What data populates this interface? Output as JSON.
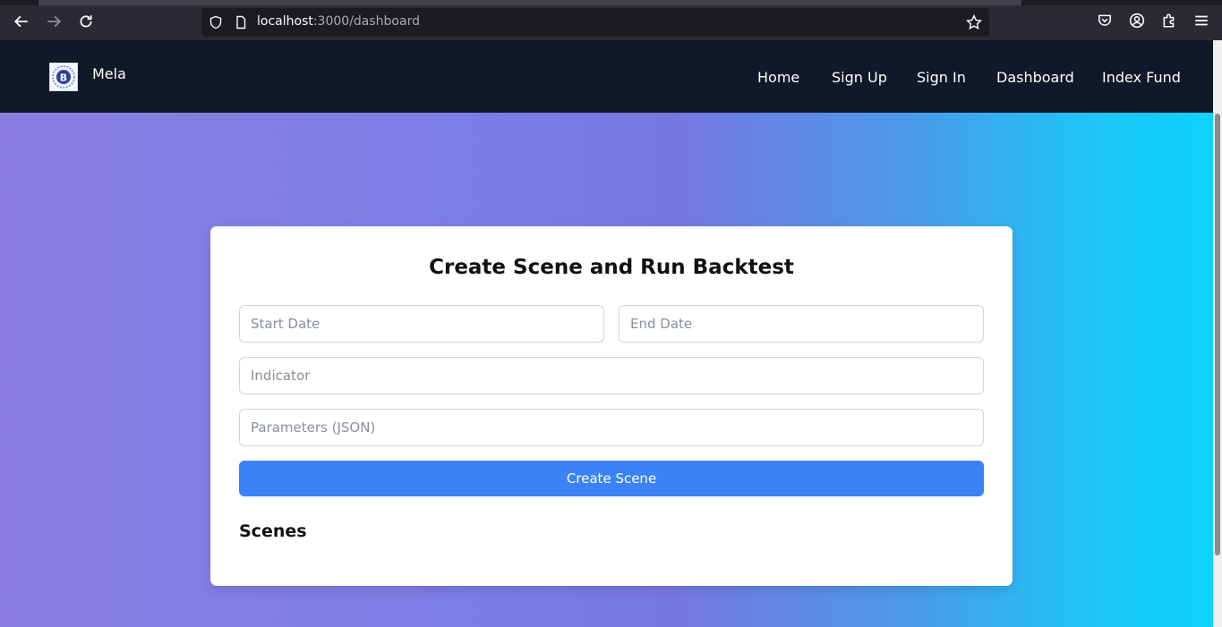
{
  "browser": {
    "url_host": "localhost",
    "url_path": ":3000/dashboard"
  },
  "navbar": {
    "brand": "Mela",
    "logo_icon": "bitcoin-logo-icon",
    "links": [
      "Home",
      "Sign Up",
      "Sign In",
      "Dashboard",
      "Index Fund"
    ]
  },
  "form": {
    "title": "Create Scene and Run Backtest",
    "start_date": {
      "placeholder": "Start Date",
      "value": ""
    },
    "end_date": {
      "placeholder": "End Date",
      "value": ""
    },
    "indicator": {
      "placeholder": "Indicator",
      "value": ""
    },
    "parameters": {
      "placeholder": "Parameters (JSON)",
      "value": ""
    },
    "submit_label": "Create Scene"
  },
  "scenes": {
    "heading": "Scenes"
  },
  "colors": {
    "navbar_bg": "#111827",
    "button_bg": "#3b82f6",
    "gradient_start": "#8b7ee0",
    "gradient_end": "#0bd3fd"
  }
}
